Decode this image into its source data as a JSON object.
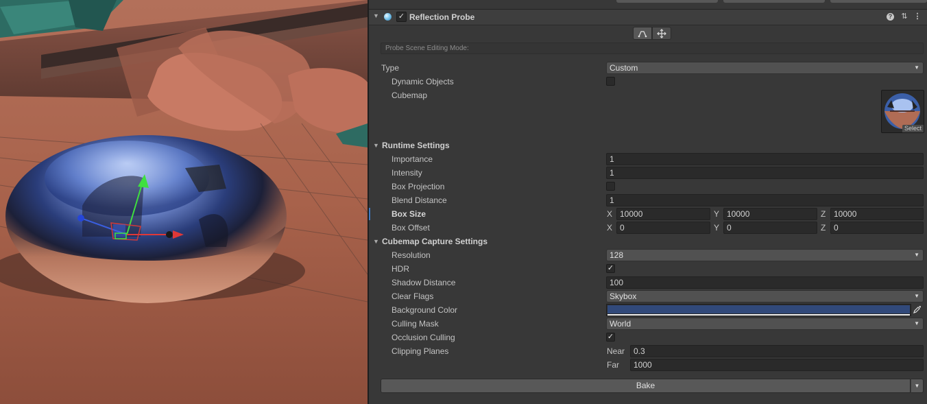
{
  "component": {
    "title": "Reflection Probe",
    "enabled": true,
    "scene_editing_mode_label": "Probe Scene Editing Mode:"
  },
  "fields": {
    "type": {
      "label": "Type",
      "value": "Custom"
    },
    "dynamic_objects": {
      "label": "Dynamic Objects",
      "checked": false
    },
    "cubemap": {
      "label": "Cubemap",
      "select_label": "Select"
    }
  },
  "runtime": {
    "header": "Runtime Settings",
    "importance": {
      "label": "Importance",
      "value": "1"
    },
    "intensity": {
      "label": "Intensity",
      "value": "1"
    },
    "box_projection": {
      "label": "Box Projection",
      "checked": false
    },
    "blend_distance": {
      "label": "Blend Distance",
      "value": "1"
    },
    "box_size": {
      "label": "Box Size",
      "x": "10000",
      "y": "10000",
      "z": "10000"
    },
    "box_offset": {
      "label": "Box Offset",
      "x": "0",
      "y": "0",
      "z": "0"
    },
    "axis": {
      "x": "X",
      "y": "Y",
      "z": "Z"
    }
  },
  "capture": {
    "header": "Cubemap Capture Settings",
    "resolution": {
      "label": "Resolution",
      "value": "128"
    },
    "hdr": {
      "label": "HDR",
      "checked": true
    },
    "shadow_distance": {
      "label": "Shadow Distance",
      "value": "100"
    },
    "clear_flags": {
      "label": "Clear Flags",
      "value": "Skybox"
    },
    "background_color": {
      "label": "Background Color",
      "color": "#31497a"
    },
    "culling_mask": {
      "label": "Culling Mask",
      "value": "World"
    },
    "occlusion_culling": {
      "label": "Occlusion Culling",
      "checked": true
    },
    "clipping_planes": {
      "label": "Clipping Planes",
      "near_label": "Near",
      "near": "0.3",
      "far_label": "Far",
      "far": "1000"
    }
  },
  "bake_button": "Bake",
  "colors": {
    "panel_bg": "#383838",
    "field_bg": "#2a2a2a",
    "button_bg": "#585858",
    "selection_accent": "#3d7ac4"
  }
}
